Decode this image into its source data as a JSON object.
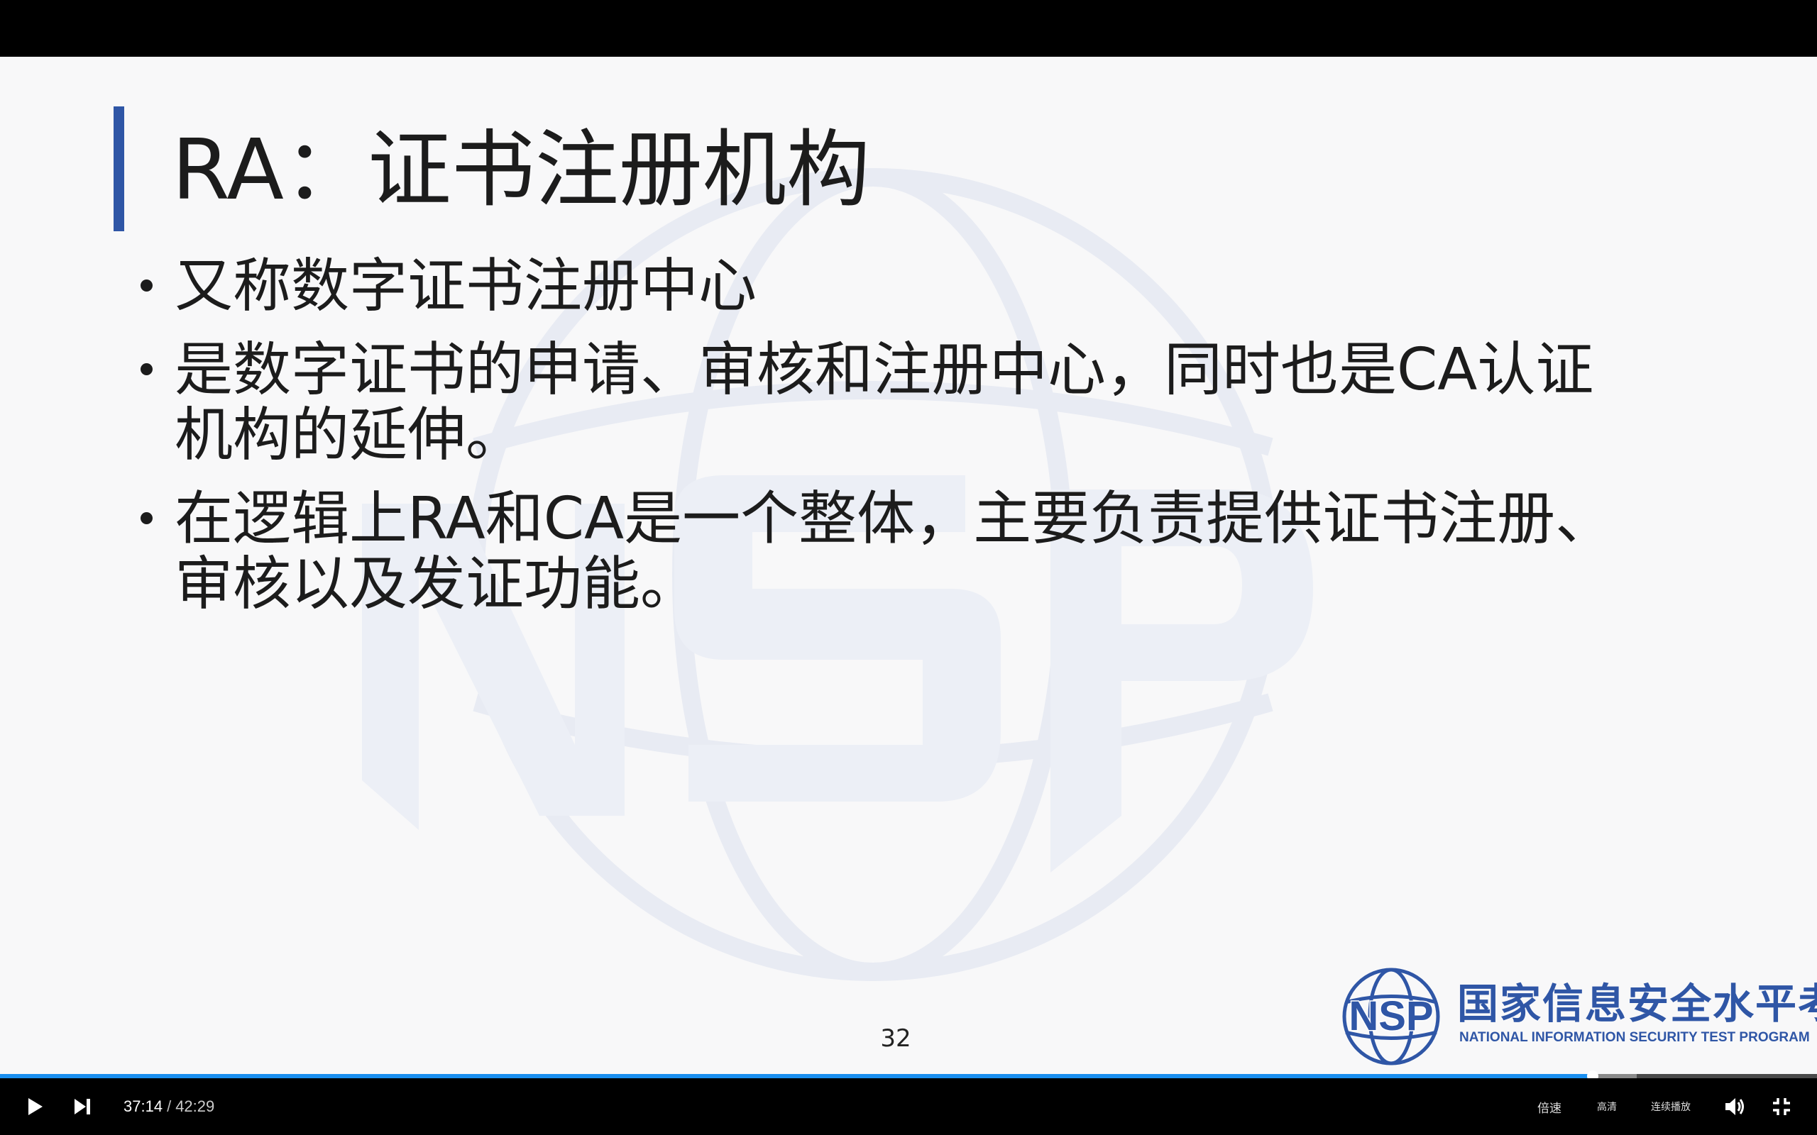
{
  "slide": {
    "title": "RA：证书注册机构",
    "bullets": [
      {
        "line1": "又称数字证书注册中心",
        "line2": ""
      },
      {
        "line1": "是数字证书的申请、审核和注册中心，同时也是CA认证",
        "line2": "机构的延伸。"
      },
      {
        "line1": "在逻辑上RA和CA是一个整体，主要负责提供证书注册、",
        "line2": "审核以及发证功能。"
      }
    ],
    "page_number": "32",
    "watermark_icon": "nsp-globe-watermark",
    "logo": {
      "mark": "NSP",
      "name_cn": "国家信息安全水平考试",
      "name_en": "NATIONAL INFORMATION SECURITY TEST PROGRAM"
    }
  },
  "player": {
    "current_time": "37:14",
    "separator": "/",
    "duration": "42:29",
    "progress_fraction": 0.8764,
    "buttons": {
      "speed": "倍速",
      "quality": "高清",
      "autoplay": "连续播放"
    },
    "icons": [
      "play-icon",
      "next-icon",
      "volume-icon",
      "exit-fullscreen-icon"
    ],
    "accent_color": "#1a8ff0"
  }
}
